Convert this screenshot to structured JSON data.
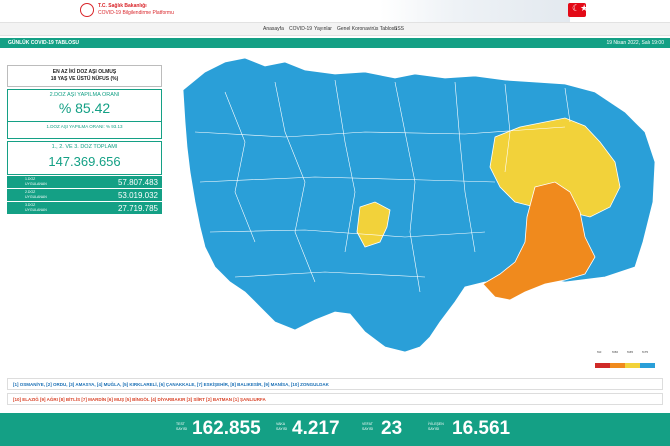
{
  "header": {
    "ministry": "T.C. Sağlık Bakanlığı",
    "platform": "COVID-19 Bilgilendirme Platformu",
    "flag_glyph": "☾★"
  },
  "nav": {
    "items": [
      "Anasayfa",
      "COVID-19",
      "Yayınlar",
      "Genel Koronavirüs Tablosu",
      "SSS"
    ]
  },
  "title": {
    "left": "GÜNLÜK COVID-19 TABLOSU",
    "date": "19 Nisan 2022, Salı 19:00"
  },
  "vaccination": {
    "headline_line1": "EN AZ İKİ DOZ AŞI OLMUŞ",
    "headline_line2": "18 YAŞ VE ÜSTÜ NÜFUS (%)",
    "dose2_label": "2.DOZ AŞI YAPILMA ORANI",
    "dose2_rate": "% 85.42",
    "dose1_rate_text": "1.DOZ AŞI YAPILMA ORANI: % 93.13",
    "total_label": "1., 2. VE 3. DOZ TOPLAMI",
    "total_value": "147.369.656",
    "doses": [
      {
        "l1": "1.DOZ",
        "l2": "UYGULANAN",
        "value": "57.807.483"
      },
      {
        "l1": "2.DOZ",
        "l2": "UYGULANAN",
        "value": "53.019.032"
      },
      {
        "l1": "3.DOZ",
        "l2": "UYGULANAN",
        "value": "27.719.785"
      }
    ]
  },
  "legend": {
    "colors": [
      "#cf2a27",
      "#f08a1d",
      "#f2d23a",
      "#2a9fd8"
    ],
    "ticks": [
      "%0",
      "%50",
      "%65",
      "%75"
    ]
  },
  "province_groups": {
    "row1": "[1] OSMANİYE,  [2] ORDU,  [3] AMASYA,  [4] MUĞLA,  [5] KIRKLARELİ,  [6] ÇANAKKALE,  [7] ESKİŞEHİR,  [8] BALIKESİR,  [9] MANİSA,  [10] ZONGULDAK",
    "row2": "[10] ELAZIĞ  [9] AĞRI  [8] BİTLİS  [7] MARDİN  [6] MUŞ  [5] BİNGÖL  [4] DİYARBAKIR  [3] SİİRT  [2] BATMAN  [1] ŞANLIURFA"
  },
  "stats": [
    {
      "l1": "TEST",
      "l2": "SAYISI",
      "value": "162.855"
    },
    {
      "l1": "VAKA",
      "l2": "SAYISI",
      "value": "4.217"
    },
    {
      "l1": "VEFAT",
      "l2": "SAYISI",
      "value": "23"
    },
    {
      "l1": "İYİLEŞEN",
      "l2": "SAYISI",
      "value": "16.561"
    }
  ],
  "map_colors": {
    "blue": "#2a9fd8",
    "yellow": "#f2d23a",
    "orange": "#f08a1d",
    "border": "#ffffff"
  }
}
